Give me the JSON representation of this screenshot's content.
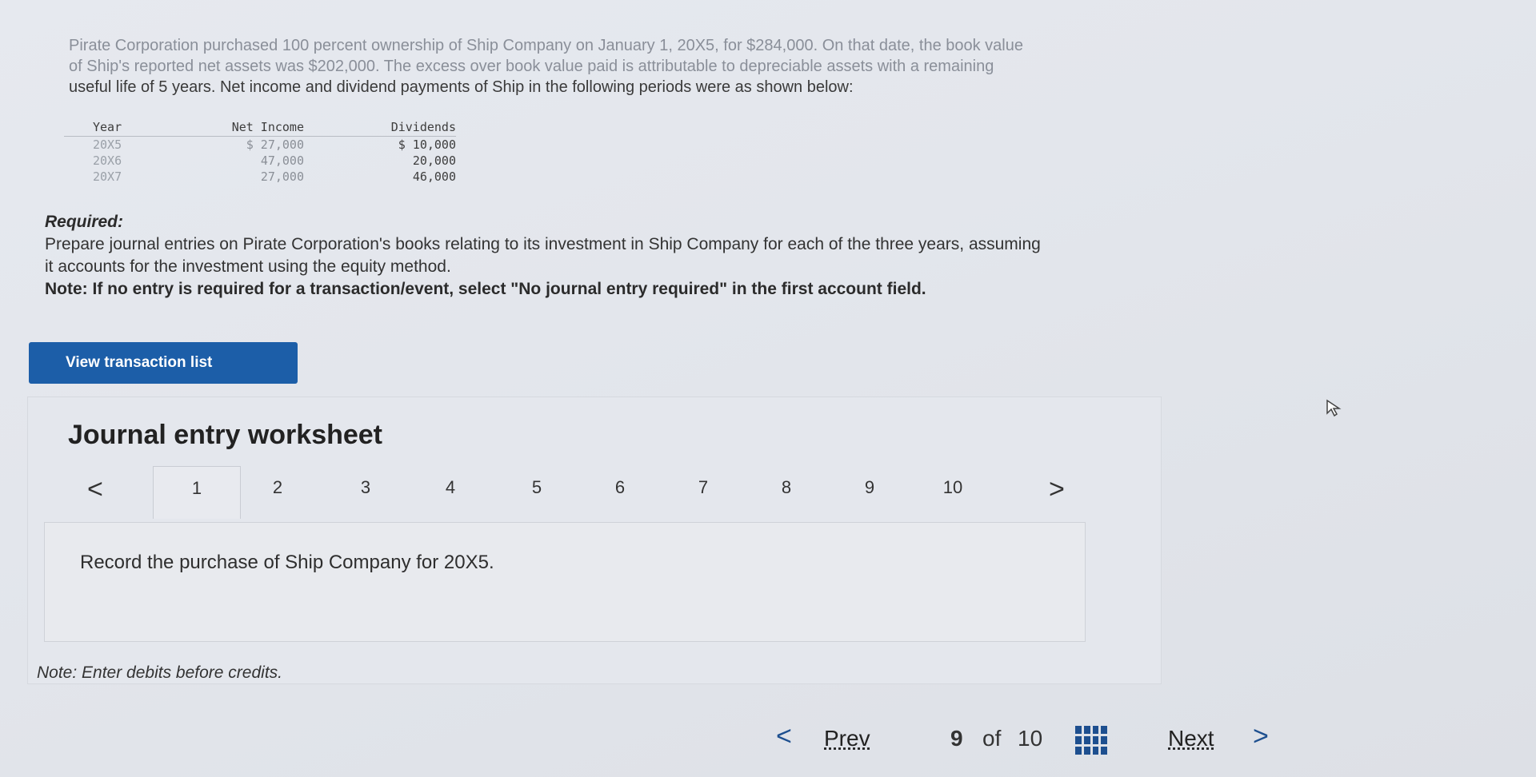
{
  "problem": {
    "line1": "Pirate Corporation purchased 100 percent ownership of Ship Company on January 1, 20X5, for $284,000. On that date, the book value",
    "line2": "of Ship's reported net assets was $202,000. The excess over book value paid is attributable to depreciable assets with a remaining",
    "line3": "useful life of 5 years. Net income and dividend payments of Ship in the following periods were as shown below:"
  },
  "table": {
    "headers": [
      "Year",
      "Net Income",
      "Dividends"
    ],
    "rows": [
      [
        "20X5",
        "$ 27,000",
        "$ 10,000"
      ],
      [
        "20X6",
        "47,000",
        "20,000"
      ],
      [
        "20X7",
        "27,000",
        "46,000"
      ]
    ]
  },
  "required": {
    "label": "Required:",
    "line1": "Prepare journal entries on Pirate Corporation's books relating to its investment in Ship Company for each of the three years, assuming",
    "line2": "it accounts for the investment using the equity method.",
    "note": "Note: If no entry is required for a transaction/event, select \"No journal entry required\" in the first account field."
  },
  "view_button": "View transaction list",
  "worksheet": {
    "title": "Journal entry worksheet",
    "tabs": [
      "1",
      "2",
      "3",
      "4",
      "5",
      "6",
      "7",
      "8",
      "9",
      "10"
    ],
    "active_tab": "1",
    "prev_arrow": "<",
    "next_arrow": ">",
    "instruction": "Record the purchase of Ship Company for 20X5."
  },
  "note_enter": "Note: Enter debits before credits.",
  "pager": {
    "prev_chev": "<",
    "prev": "Prev",
    "current": "9",
    "of": "of",
    "total": "10",
    "next": "Next",
    "next_chev": ">"
  },
  "colors": {
    "button_bg": "#1c5ea8",
    "link_chev": "#1d4f8f"
  },
  "icons": [
    "grid-icon",
    "cursor-icon",
    "chevron-left-icon",
    "chevron-right-icon"
  ]
}
